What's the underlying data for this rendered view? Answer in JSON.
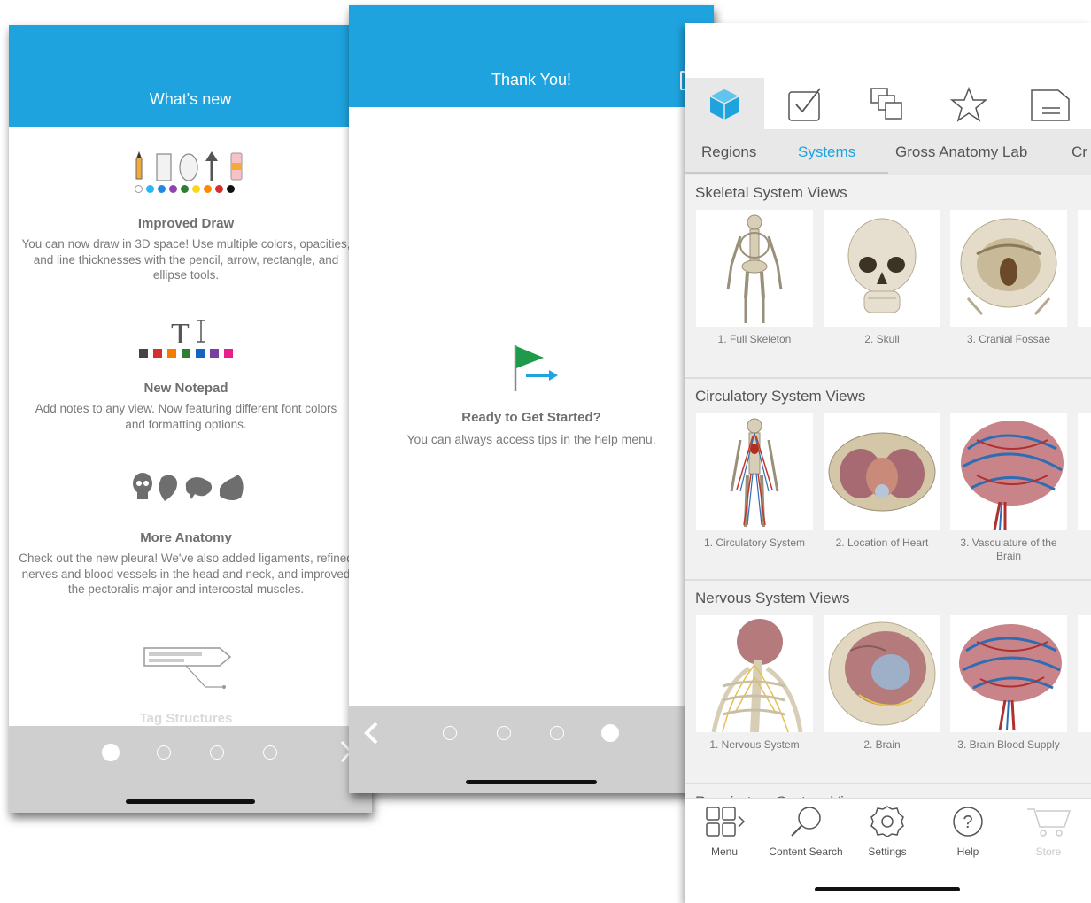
{
  "panel_whats_new": {
    "title": "What's new",
    "features": [
      {
        "icon": "draw-tools-icon",
        "title": "Improved Draw",
        "desc": "You can now draw in 3D space! Use multiple colors, opacities, and line thicknesses with the pencil, arrow, rectangle, and ellipse tools."
      },
      {
        "icon": "notepad-icon",
        "title": "New Notepad",
        "desc": "Add notes to any view. Now featuring different font colors and formatting options."
      },
      {
        "icon": "anatomy-icons",
        "title": "More Anatomy",
        "desc": "Check out the new pleura! We've also added ligaments, refined nerves and blood vessels in the head and neck, and improved the pectoralis major and intercostal muscles."
      },
      {
        "icon": "tag-structures-icon",
        "title": "Tag Structures",
        "desc": ""
      }
    ],
    "draw_colors": [
      "#ffffff",
      "#29b6f6",
      "#1e88e5",
      "#8e44ad",
      "#2e7d32",
      "#f9d71c",
      "#fb8c00",
      "#d32f2f",
      "#111111"
    ],
    "note_colors": [
      "#444444",
      "#d32f2f",
      "#f57c00",
      "#2e7d32",
      "#1565c0",
      "#7b3fa0",
      "#e91e8c"
    ],
    "pager": {
      "count": 4,
      "active": 0
    }
  },
  "panel_thank_you": {
    "title": "Thank You!",
    "heading": "Ready to Get Started?",
    "subtext": "You can always access tips in the help menu.",
    "pager": {
      "count": 4,
      "active": 3
    }
  },
  "panel_app": {
    "tabs": [
      "Regions",
      "Systems",
      "Gross Anatomy Lab",
      "Cr"
    ],
    "selected_tab": "Systems",
    "sections": [
      {
        "title": "Skeletal System Views",
        "items": [
          "1. Full Skeleton",
          "2. Skull",
          "3. Cranial Fossae"
        ]
      },
      {
        "title": "Circulatory System Views",
        "items": [
          "1. Circulatory System",
          "2. Location of Heart",
          "3. Vasculature of the Brain"
        ]
      },
      {
        "title": "Nervous System Views",
        "items": [
          "1. Nervous System",
          "2. Brain",
          "3. Brain Blood Supply"
        ]
      },
      {
        "title": "Respiratory System Views",
        "items": []
      }
    ],
    "bottom_nav": [
      "Menu",
      "Content Search",
      "Settings",
      "Help",
      "Store"
    ],
    "accent": "#1ea3de"
  }
}
